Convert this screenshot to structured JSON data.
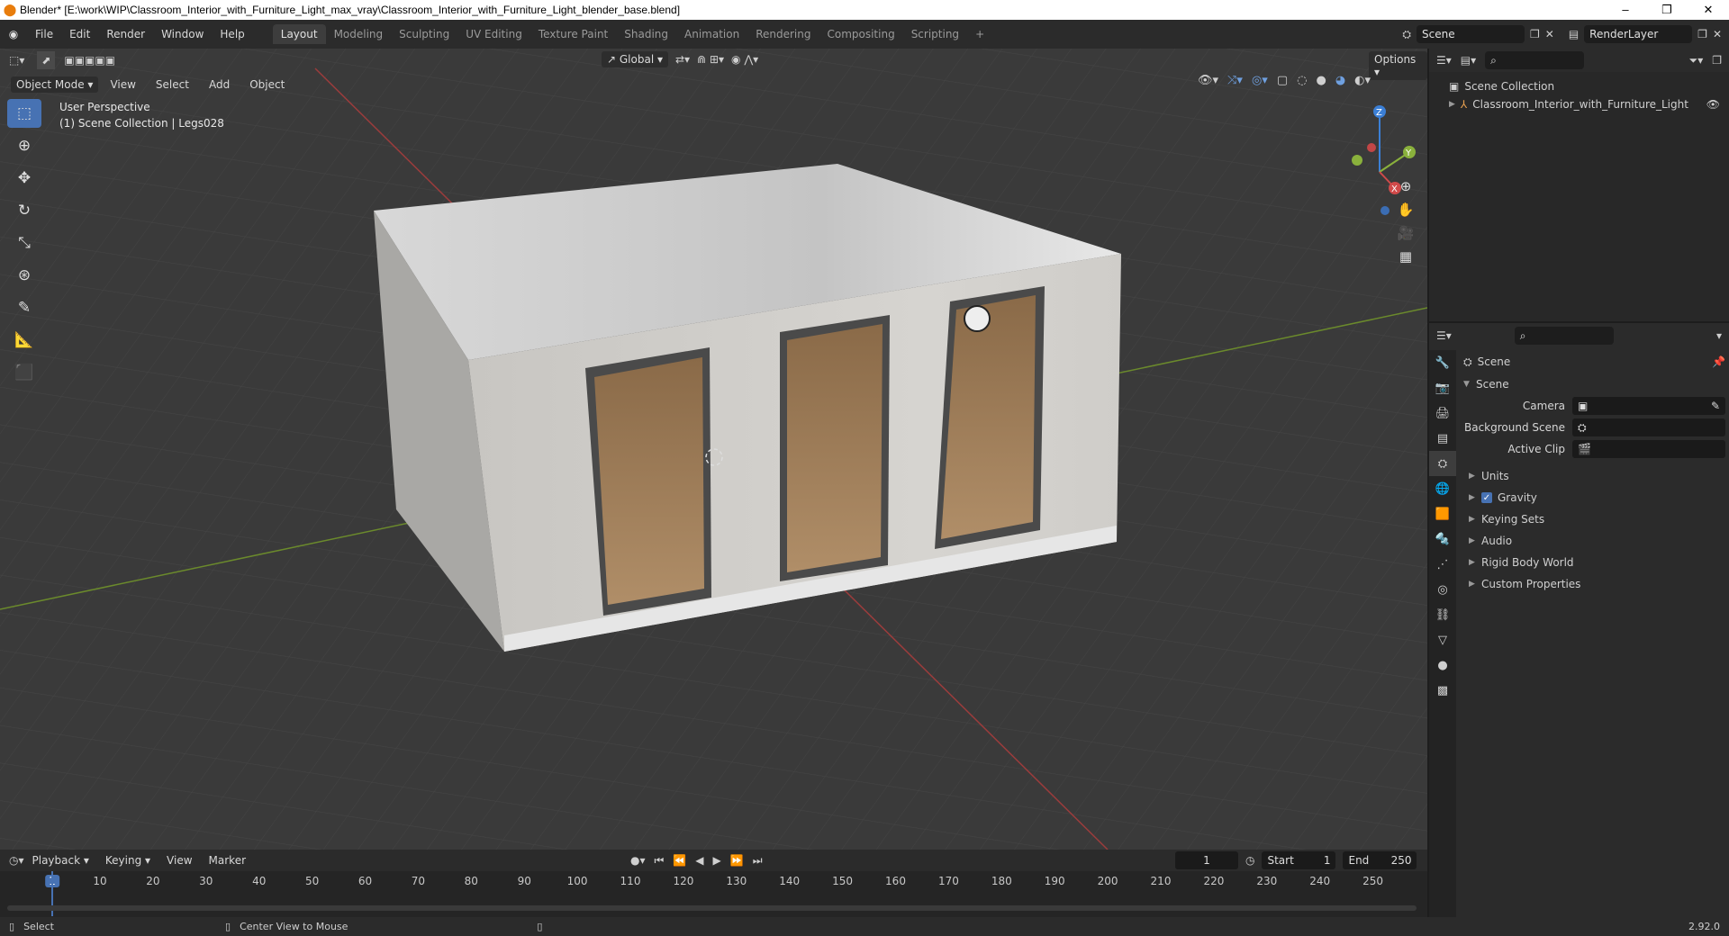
{
  "window": {
    "title": "Blender* [E:\\work\\WIP\\Classroom_Interior_with_Furniture_Light_max_vray\\Classroom_Interior_with_Furniture_Light_blender_base.blend]",
    "minimize": "–",
    "maximize": "❐",
    "close": "✕"
  },
  "menu": [
    "File",
    "Edit",
    "Render",
    "Window",
    "Help"
  ],
  "workspaces": [
    {
      "label": "Layout",
      "active": true
    },
    {
      "label": "Modeling"
    },
    {
      "label": "Sculpting"
    },
    {
      "label": "UV Editing"
    },
    {
      "label": "Texture Paint"
    },
    {
      "label": "Shading"
    },
    {
      "label": "Animation"
    },
    {
      "label": "Rendering"
    },
    {
      "label": "Compositing"
    },
    {
      "label": "Scripting"
    }
  ],
  "topbar": {
    "add_workspace": "+",
    "scene": "Scene",
    "view_layer": "RenderLayer"
  },
  "viewport": {
    "mode": "Object Mode",
    "menus": [
      "View",
      "Select",
      "Add",
      "Object"
    ],
    "transform_orientation": "Global",
    "options": "Options",
    "overlay_line1": "User Perspective",
    "overlay_line2": "(1) Scene Collection | Legs028",
    "gizmo": {
      "x": "X",
      "y": "Y",
      "z": "Z"
    }
  },
  "outliner": {
    "root": "Scene Collection",
    "items": [
      {
        "label": "Classroom_Interior_with_Furniture_Light"
      }
    ]
  },
  "properties": {
    "header": "Scene",
    "section": "Scene",
    "rows": [
      {
        "label": "Camera",
        "value": ""
      },
      {
        "label": "Background Scene",
        "value": ""
      },
      {
        "label": "Active Clip",
        "value": ""
      }
    ],
    "subpanels": [
      {
        "label": "Units"
      },
      {
        "label": "Gravity",
        "checkbox": true
      },
      {
        "label": "Keying Sets"
      },
      {
        "label": "Audio"
      },
      {
        "label": "Rigid Body World"
      },
      {
        "label": "Custom Properties"
      }
    ]
  },
  "timeline": {
    "menus": [
      "Playback",
      "Keying",
      "View",
      "Marker"
    ],
    "current_frame": "1",
    "start_label": "Start",
    "start": "1",
    "end_label": "End",
    "end": "250",
    "ticks": [
      "1",
      "10",
      "20",
      "30",
      "40",
      "50",
      "60",
      "70",
      "80",
      "90",
      "100",
      "110",
      "120",
      "130",
      "140",
      "150",
      "160",
      "170",
      "180",
      "190",
      "200",
      "210",
      "220",
      "230",
      "240",
      "250"
    ]
  },
  "status": {
    "left": "Select",
    "middle": "Center View to Mouse",
    "version": "2.92.0"
  },
  "colors": {
    "accent": "#4772b3",
    "bg": "#1d1d1d",
    "viewport": "#3a3a3a"
  }
}
